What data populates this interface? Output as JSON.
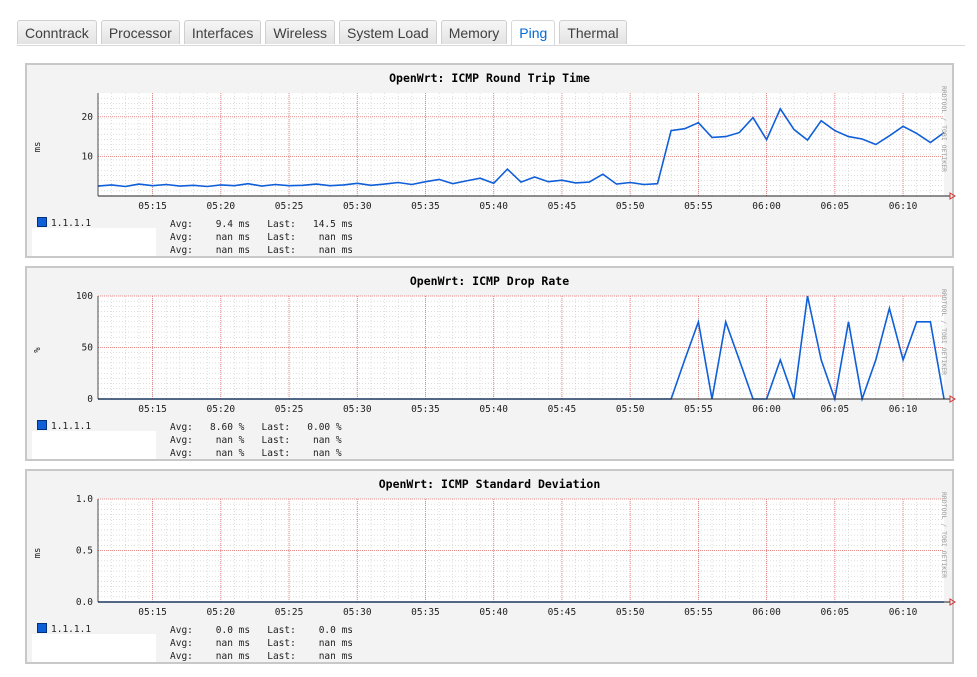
{
  "tabs": [
    {
      "label": "Conntrack",
      "active": false
    },
    {
      "label": "Processor",
      "active": false
    },
    {
      "label": "Interfaces",
      "active": false
    },
    {
      "label": "Wireless",
      "active": false
    },
    {
      "label": "System Load",
      "active": false
    },
    {
      "label": "Memory",
      "active": false
    },
    {
      "label": "Ping",
      "active": true
    },
    {
      "label": "Thermal",
      "active": false
    }
  ],
  "colors": {
    "series": "#0f5fd9",
    "grid_major": "#e07070",
    "grid_minor": "#c8c8c8",
    "canvas": "#ffffff",
    "panel": "#f3f3f3"
  },
  "watermark": "RRDTOOL / TOBI OETIKER",
  "x_ticks": [
    "05:15",
    "05:20",
    "05:25",
    "05:30",
    "05:35",
    "05:40",
    "05:45",
    "05:50",
    "05:55",
    "06:00",
    "06:05",
    "06:10"
  ],
  "graphs": [
    {
      "title": "OpenWrt: ICMP Round Trip Time",
      "ylabel": "ms",
      "legend": "1.1.1.1",
      "stats": [
        "Avg:    9.4 ms   Last:   14.5 ms",
        "Avg:    nan ms   Last:    nan ms",
        "Avg:    nan ms   Last:    nan ms"
      ],
      "chart_data": {
        "type": "line",
        "x_range": [
          "05:11",
          "06:13"
        ],
        "ylim": [
          0,
          26
        ],
        "y_ticks": [
          "20",
          "10"
        ],
        "y_tick_values": [
          20,
          10
        ],
        "series": [
          {
            "name": "1.1.1.1",
            "x": [
              0,
              1,
              2,
              3,
              4,
              5,
              6,
              7,
              8,
              9,
              10,
              11,
              12,
              13,
              14,
              15,
              16,
              17,
              18,
              19,
              20,
              21,
              22,
              23,
              24,
              25,
              26,
              27,
              28,
              29,
              30,
              31,
              32,
              33,
              34,
              35,
              36,
              37,
              38,
              39,
              40,
              41,
              42,
              43,
              44,
              45,
              46,
              47,
              48,
              49,
              50,
              51,
              52,
              53,
              54,
              55,
              56,
              57,
              58,
              59,
              60,
              61,
              62
            ],
            "values": [
              2.5,
              2.8,
              2.4,
              3.0,
              2.6,
              2.9,
              2.5,
              2.7,
              2.4,
              2.8,
              2.6,
              3.1,
              2.5,
              2.9,
              2.6,
              2.7,
              3.0,
              2.6,
              2.8,
              3.2,
              2.7,
              3.0,
              3.4,
              2.9,
              3.6,
              4.2,
              3.1,
              3.8,
              4.5,
              3.2,
              6.8,
              3.5,
              4.8,
              3.6,
              4.0,
              3.3,
              3.5,
              5.5,
              3.0,
              3.4,
              2.9,
              3.1,
              16.5,
              17.0,
              18.5,
              14.8,
              15.0,
              16.0,
              19.8,
              14.2,
              22.0,
              16.8,
              14.1,
              19.0,
              16.5,
              15.0,
              14.4,
              13.0,
              15.2,
              17.6,
              15.8,
              13.5,
              16.0
            ]
          }
        ]
      }
    },
    {
      "title": "OpenWrt: ICMP Drop Rate",
      "ylabel": "%",
      "legend": "1.1.1.1",
      "stats": [
        "Avg:   8.60 %   Last:   0.00 %",
        "Avg:    nan %   Last:    nan %",
        "Avg:    nan %   Last:    nan %"
      ],
      "chart_data": {
        "type": "line",
        "x_range": [
          "05:11",
          "06:13"
        ],
        "ylim": [
          0,
          100
        ],
        "y_ticks": [
          "100",
          "50",
          "0"
        ],
        "y_tick_values": [
          100,
          50,
          0
        ],
        "series": [
          {
            "name": "1.1.1.1",
            "x": [
              0,
              10,
              20,
              30,
              40,
              42,
              43,
              44,
              45,
              46,
              47,
              48,
              49,
              50,
              51,
              52,
              53,
              54,
              55,
              56,
              57,
              58,
              59,
              60,
              61,
              62
            ],
            "values": [
              0,
              0,
              0,
              0,
              0,
              0,
              38,
              75,
              0,
              75,
              38,
              0,
              0,
              38,
              0,
              100,
              38,
              0,
              75,
              0,
              38,
              88,
              38,
              75,
              75,
              0
            ]
          }
        ]
      }
    },
    {
      "title": "OpenWrt: ICMP Standard Deviation",
      "ylabel": "ms",
      "legend": "1.1.1.1",
      "stats": [
        "Avg:    0.0 ms   Last:    0.0 ms",
        "Avg:    nan ms   Last:    nan ms",
        "Avg:    nan ms   Last:    nan ms"
      ],
      "chart_data": {
        "type": "line",
        "x_range": [
          "05:11",
          "06:13"
        ],
        "ylim": [
          0,
          1.0
        ],
        "y_ticks": [
          "1.0",
          "0.5",
          "0.0"
        ],
        "y_tick_values": [
          1.0,
          0.5,
          0.0
        ],
        "series": [
          {
            "name": "1.1.1.1",
            "x": [
              0,
              62
            ],
            "values": [
              0,
              0
            ]
          }
        ]
      }
    }
  ]
}
